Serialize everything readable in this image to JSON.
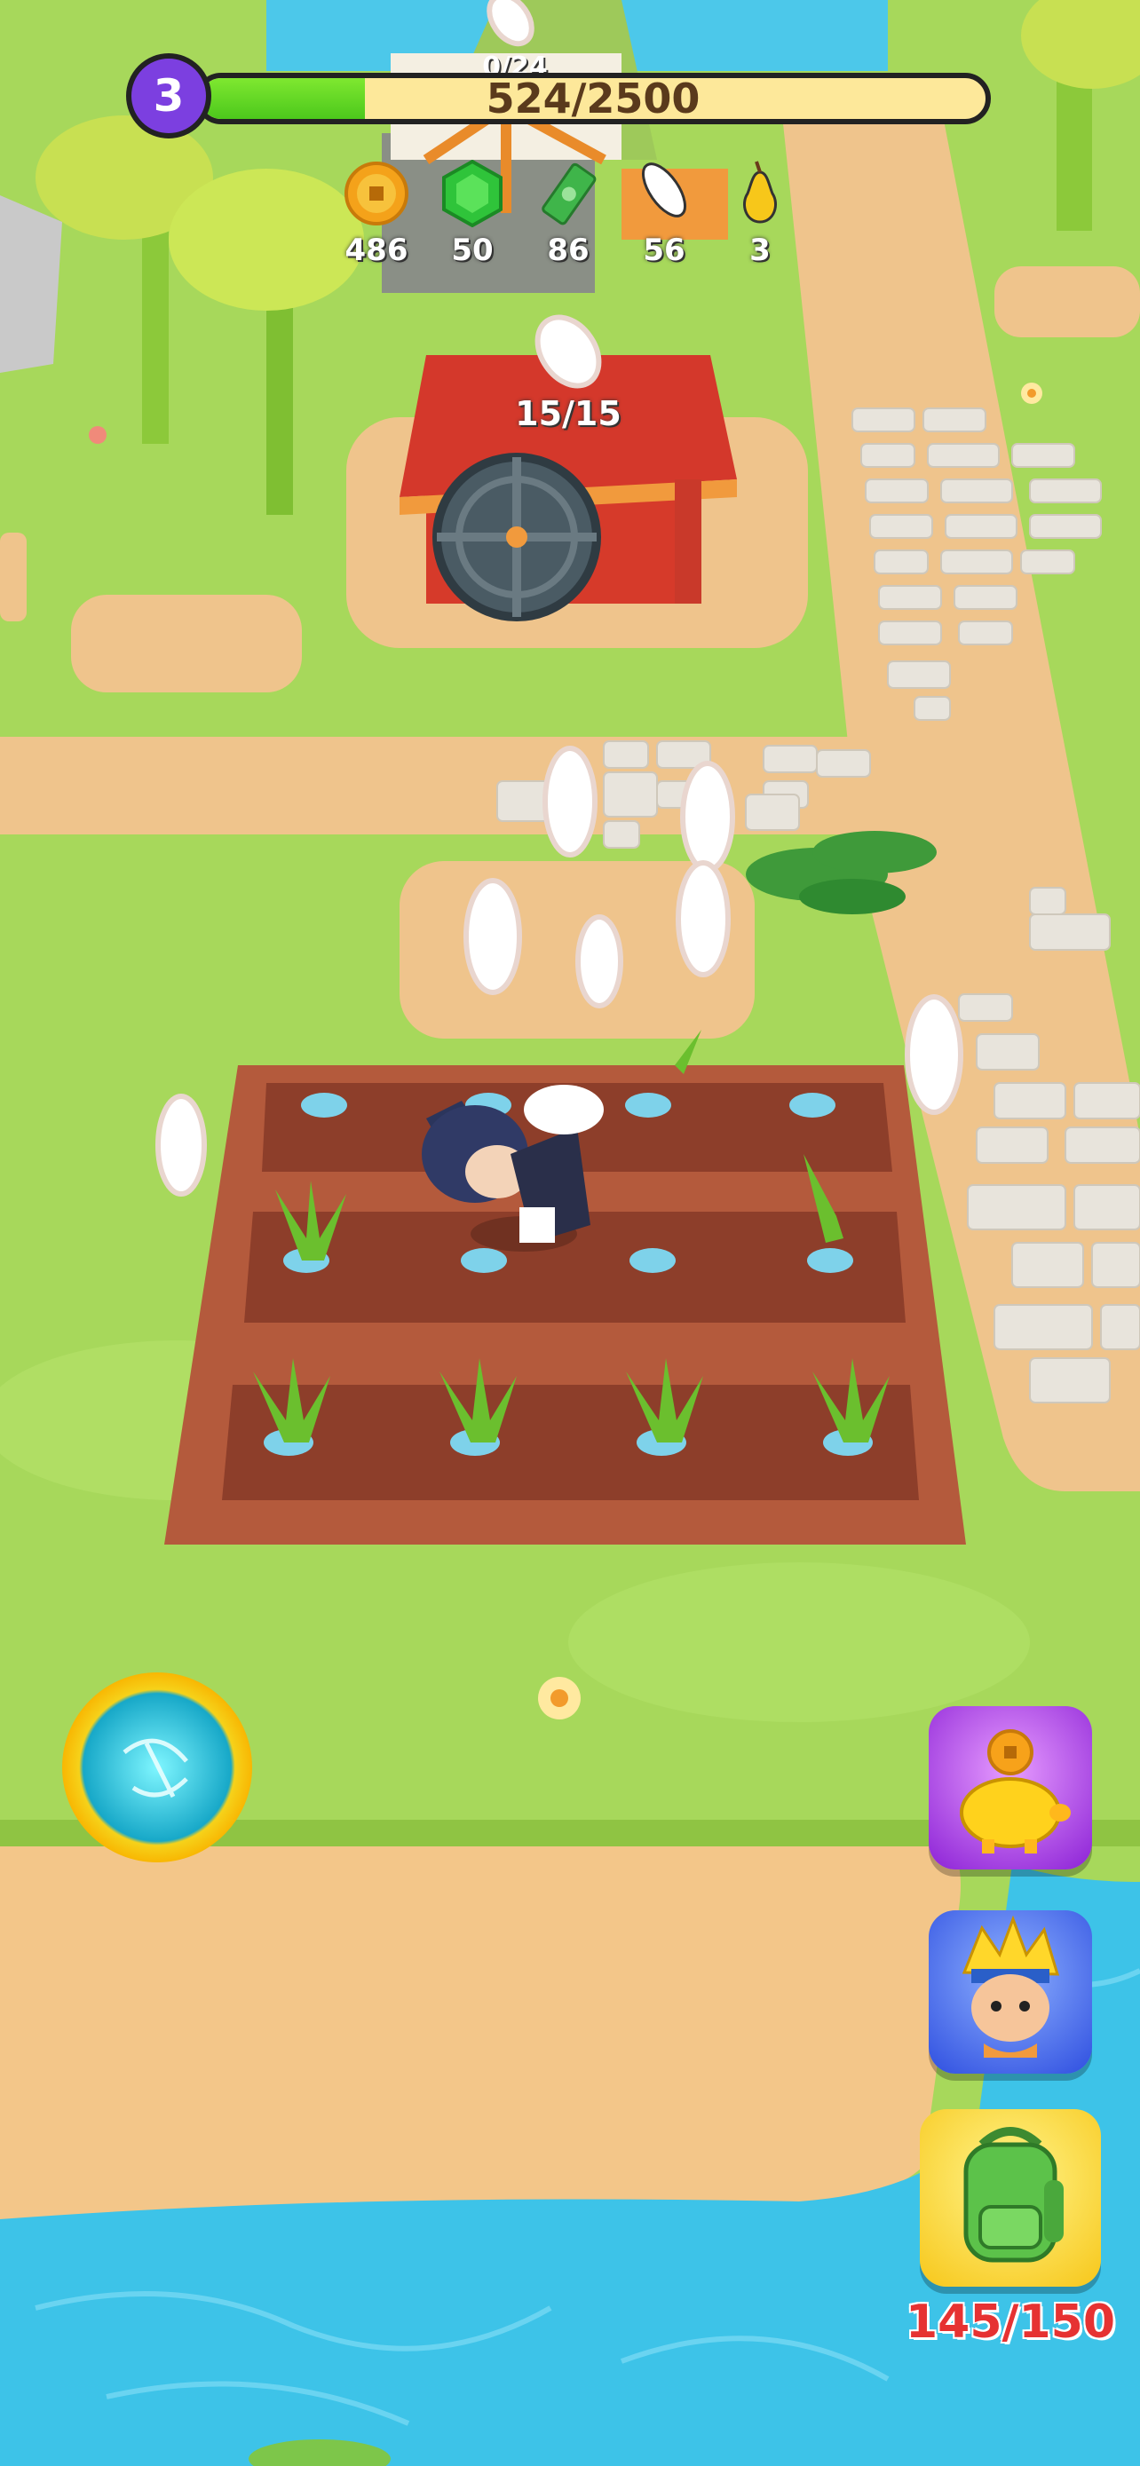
{
  "hud": {
    "level": "3",
    "xp_text": "524/2500",
    "xp_progress": 0.2096,
    "top_counter": "0/24"
  },
  "resources": [
    {
      "icon": "coin-icon",
      "count": "486"
    },
    {
      "icon": "gem-icon",
      "count": "50"
    },
    {
      "icon": "cash-icon",
      "count": "86"
    },
    {
      "icon": "rice-grain-icon",
      "count": "56"
    },
    {
      "icon": "pear-icon",
      "count": "3"
    }
  ],
  "mill": {
    "count_text": "15/15"
  },
  "buttons": {
    "piggy_bank": "piggy-bank-icon",
    "hero": "hero-icon",
    "backpack": "backpack-icon",
    "portal": "portal-icon"
  },
  "backpack": {
    "count_text": "145/150"
  },
  "colors": {
    "grass": "#a7d85b",
    "path": "#efc48c",
    "soil": "#b45a3c",
    "water": "#3dc3e8",
    "level_badge": "#7c3fe0",
    "xp_fill": "#58d022",
    "bag_count": "#e63232"
  }
}
